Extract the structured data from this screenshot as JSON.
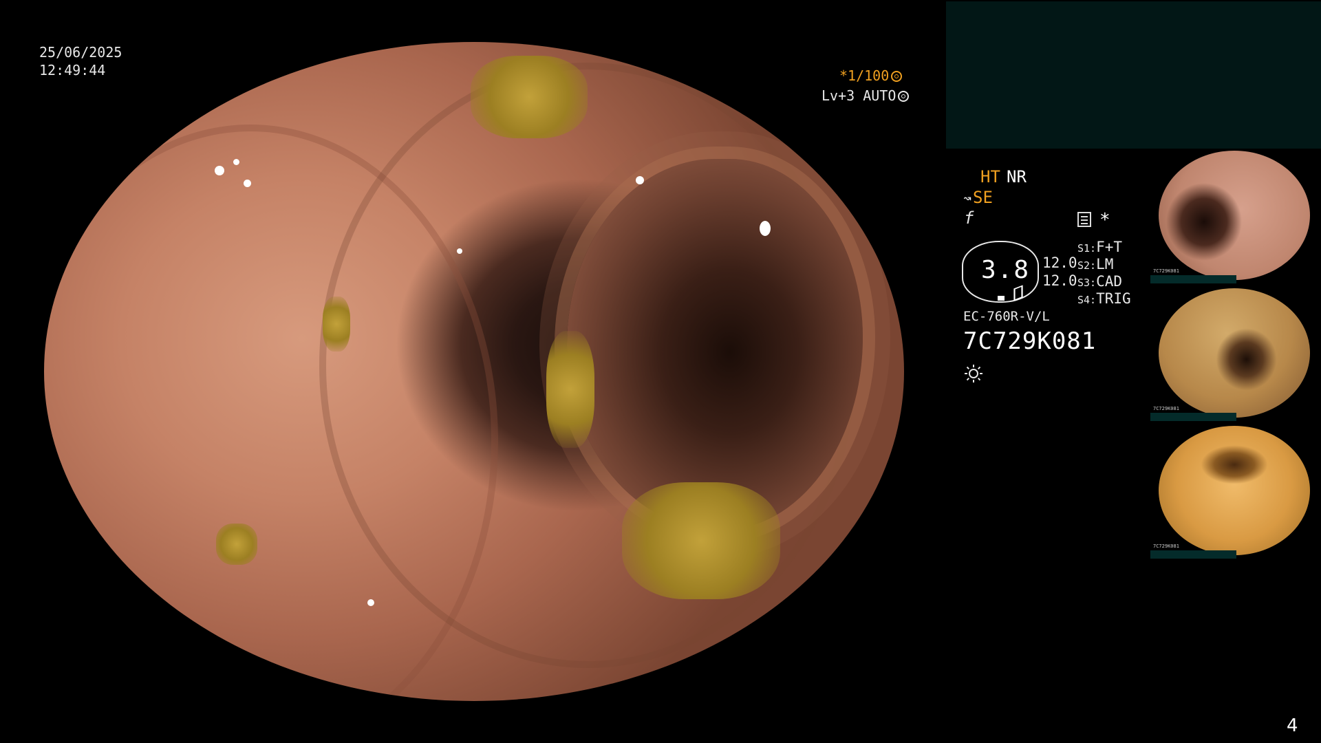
{
  "overlay": {
    "date": "25/06/2025",
    "time": "12:49:44",
    "shutter": "*1/100",
    "level": "Lv+3 AUTO"
  },
  "panel": {
    "mode_ht": "HT",
    "mode_nr": "NR",
    "mode_se": "SE",
    "f_symbol": "f",
    "asterisk": "*",
    "ratio_value": "3.8",
    "value1": "12.0",
    "value2": "12.0",
    "switches": [
      {
        "key": "S1:",
        "label": "F+T"
      },
      {
        "key": "S2:",
        "label": "LM"
      },
      {
        "key": "S3:",
        "label": "CAD"
      },
      {
        "key": "S4:",
        "label": "TRIG"
      }
    ],
    "scope_model": "EC-760R-V/L",
    "scope_serial": "7C729K081"
  },
  "thumbnails": [
    {
      "name": "thumbnail-1",
      "index": "1",
      "serial": "7C729K081"
    },
    {
      "name": "thumbnail-2",
      "index": "2",
      "serial": "7C729K081"
    },
    {
      "name": "thumbnail-3",
      "index": "3",
      "serial": "7C729K081"
    }
  ],
  "page_number": "4",
  "icons": [
    "aperture-icon",
    "auto-iris-icon",
    "insertion-arrow-icon",
    "menu-icon",
    "sun-icon"
  ],
  "colors": {
    "accent": "#f0a020",
    "panel": "#021716",
    "background": "#000000"
  }
}
